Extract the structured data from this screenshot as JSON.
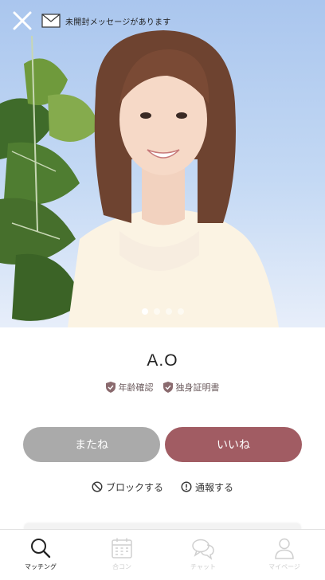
{
  "header": {
    "close_icon": "close-icon",
    "mail_icon": "envelope-icon",
    "notice_text": "未開封メッセージがあります"
  },
  "photo": {
    "count": 4,
    "active_index": 0
  },
  "profile": {
    "name": "A.O",
    "badges": [
      {
        "icon": "shield-check-icon",
        "label": "年齢確認"
      },
      {
        "icon": "shield-check-icon",
        "label": "独身証明書"
      }
    ]
  },
  "buttons": {
    "skip_label": "またね",
    "like_label": "いいね"
  },
  "actions": {
    "block_label": "ブロックする",
    "report_label": "通報する"
  },
  "nav": {
    "items": [
      {
        "label": "マッチング",
        "icon": "search-icon",
        "active": true
      },
      {
        "label": "合コン",
        "icon": "calendar-icon",
        "active": false
      },
      {
        "label": "チャット",
        "icon": "chat-icon",
        "active": false
      },
      {
        "label": "マイページ",
        "icon": "person-icon",
        "active": false
      }
    ]
  },
  "colors": {
    "like": "#a15c63",
    "skip": "#aaaaaa",
    "badge": "#8a6a6e",
    "nav_inactive": "#cfcfcf"
  }
}
